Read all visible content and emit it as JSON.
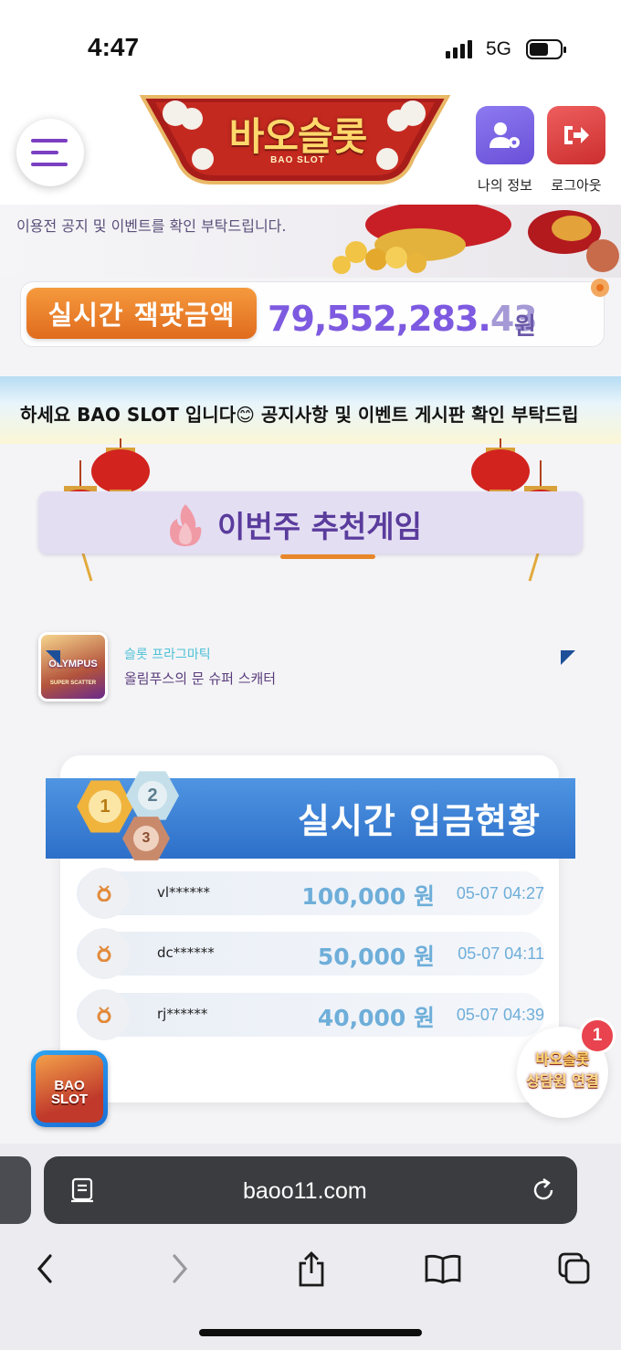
{
  "status_bar": {
    "time": "4:47",
    "network": "5G"
  },
  "header": {
    "logo_title": "바오슬롯",
    "logo_subtitle": "BAO SLOT",
    "my_info_label": "나의 정보",
    "logout_label": "로그아웃"
  },
  "notice": {
    "text": "이용전 공지 및 이벤트를 확인 부탁드립니다."
  },
  "jackpot": {
    "label": "실시간 잭팟금액",
    "value": "79,552,283.",
    "value_suffix": "43",
    "unit": "원"
  },
  "marquee": {
    "text": "하세요 BAO SLOT 입니다😊 공지사항 및 이벤트 게시판 확인 부탁드립"
  },
  "recommend": {
    "title": "이번주 추천게임",
    "game": {
      "thumb_title": "OLYMPUS",
      "thumb_subtitle": "SUPER SCATTER",
      "provider": "슬롯 프라그마틱",
      "name": "올림푸스의 문 슈퍼 스캐터"
    }
  },
  "deposits": {
    "title": "실시간 입금현황",
    "medals": [
      "1",
      "2",
      "3"
    ],
    "rows": [
      {
        "user": "vl******",
        "amount": "100,000 원",
        "date": "05-07 04:27"
      },
      {
        "user": "dc******",
        "amount": "50,000 원",
        "date": "05-07 04:11"
      },
      {
        "user": "rj******",
        "amount": "40,000 원",
        "date": "05-07 04:39"
      }
    ]
  },
  "float_logo": {
    "line1": "BAO",
    "line2": "SLOT"
  },
  "consult": {
    "logo": "바오슬롯",
    "label": "상담원 연결",
    "badge": "1"
  },
  "browser": {
    "url": "baoo11.com"
  },
  "colors": {
    "purple": "#7b3fc2",
    "orange": "#e8862a",
    "blue": "#2d6fc9",
    "amount": "#6eaed9"
  }
}
